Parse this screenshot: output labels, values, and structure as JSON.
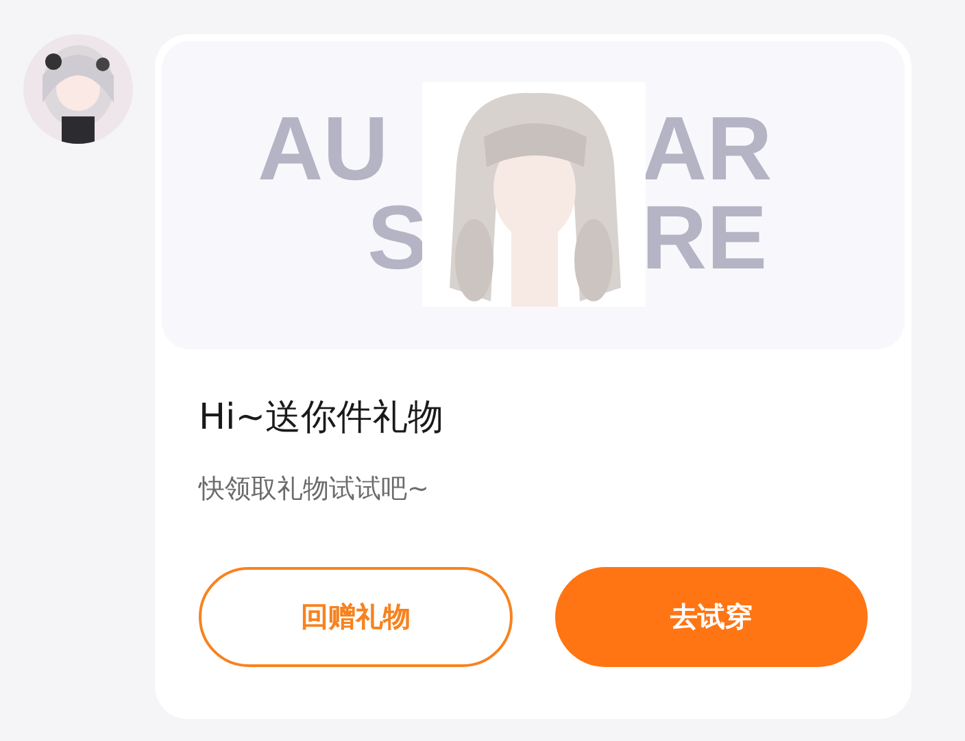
{
  "banner": {
    "background_text": [
      [
        "AU",
        "AR"
      ],
      [
        "S",
        "RE"
      ]
    ]
  },
  "title": "Hi~送你件礼物",
  "subtitle": "快领取礼物试试吧~",
  "buttons": [
    {
      "label": "回赠礼物",
      "kind": "outline"
    },
    {
      "label": "去试穿",
      "kind": "primary"
    }
  ]
}
